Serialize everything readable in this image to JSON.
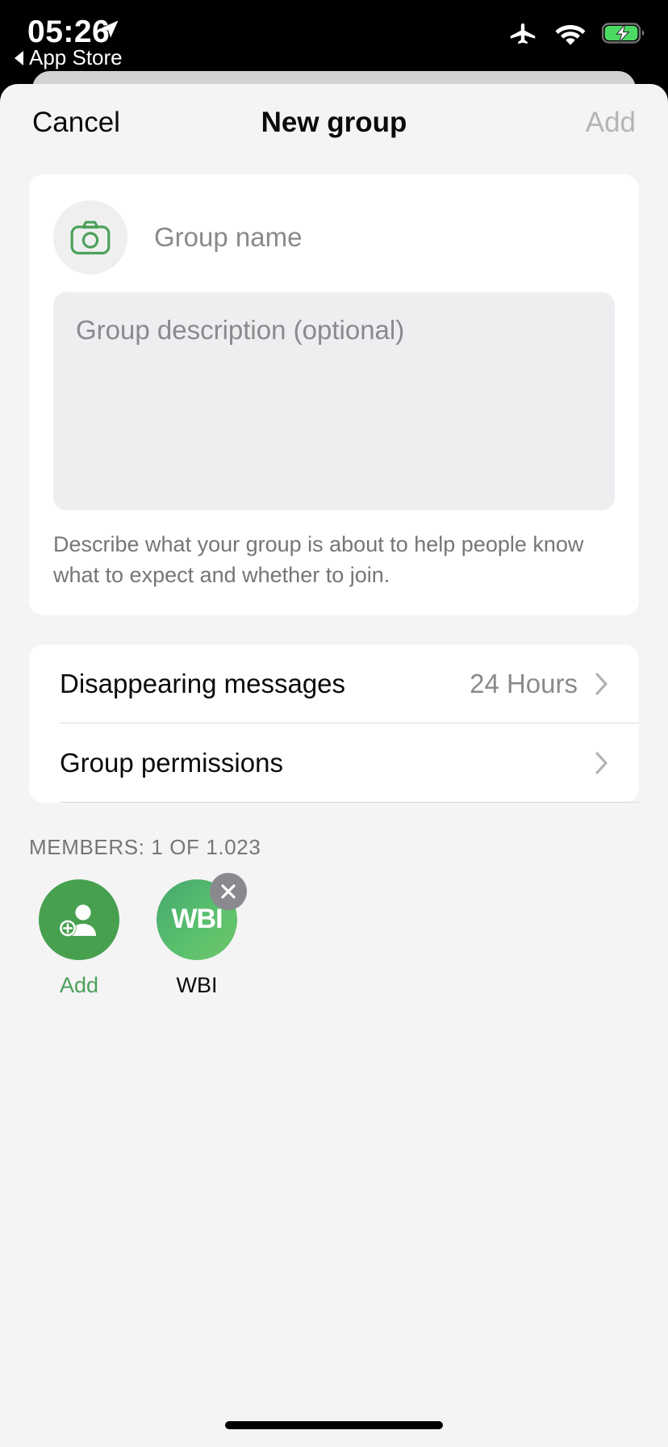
{
  "status_bar": {
    "time": "05:26",
    "back_app": "App Store",
    "icons": [
      "location-arrow-icon",
      "airplane-mode-icon",
      "wifi-icon",
      "battery-charging-icon"
    ],
    "battery_color": "#4CD964"
  },
  "nav": {
    "cancel_label": "Cancel",
    "title": "New group",
    "add_label": "Add",
    "add_color": "#b5b5b7"
  },
  "group_form": {
    "camera_icon": "camera-icon",
    "camera_icon_color": "#4da15b",
    "name_placeholder": "Group name",
    "name_value": "",
    "description_placeholder": "Group description (optional)",
    "description_value": "",
    "description_help": "Describe what your group is about to help people know what to expect and whether to join."
  },
  "settings": {
    "rows": [
      {
        "label": "Disappearing messages",
        "value": "24 Hours",
        "chevron": "chevron-right-icon"
      },
      {
        "label": "Group permissions",
        "value": "",
        "chevron": "chevron-right-icon"
      }
    ]
  },
  "members": {
    "header": "MEMBERS: 1 OF 1.023",
    "add_button": {
      "label": "Add",
      "icon": "add-person-icon",
      "color": "#46a04e",
      "label_color": "#4da15b"
    },
    "entries": [
      {
        "initials": "WBI",
        "label": "WBI",
        "remove_icon": "close-icon",
        "avatar_color": "#59c06d"
      }
    ]
  }
}
